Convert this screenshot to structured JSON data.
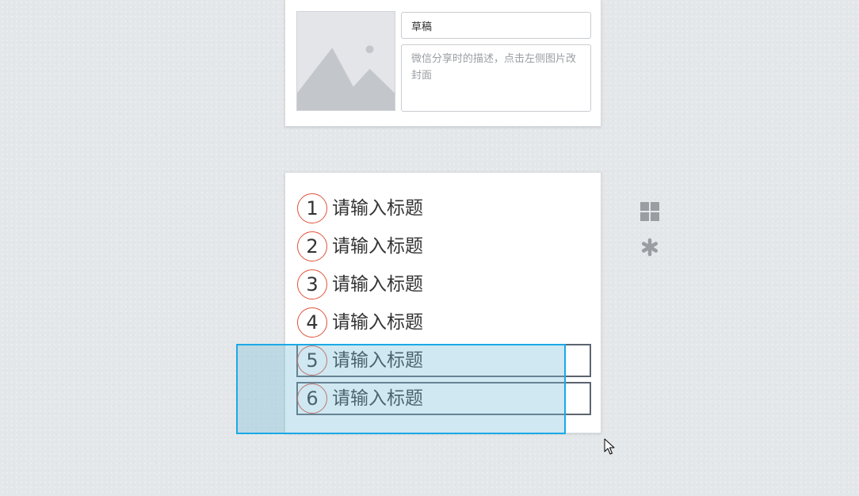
{
  "share_card": {
    "title_value": "草稿",
    "description_placeholder": "微信分享时的描述，点击左侧图片改封面",
    "cover_icon": "image-placeholder-icon"
  },
  "menu": {
    "items": [
      {
        "number": "1",
        "label": "请输入标题"
      },
      {
        "number": "2",
        "label": "请输入标题"
      },
      {
        "number": "3",
        "label": "请输入标题"
      },
      {
        "number": "4",
        "label": "请输入标题"
      },
      {
        "number": "5",
        "label": "请输入标题"
      },
      {
        "number": "6",
        "label": "请输入标题"
      }
    ]
  },
  "side_tools": {
    "grid_icon": "grid-icon",
    "asterisk_icon": "asterisk-icon"
  },
  "colors": {
    "circle_border": "#e0533c",
    "selection_border": "#1aa9e6",
    "background": "#e4e7ea"
  }
}
